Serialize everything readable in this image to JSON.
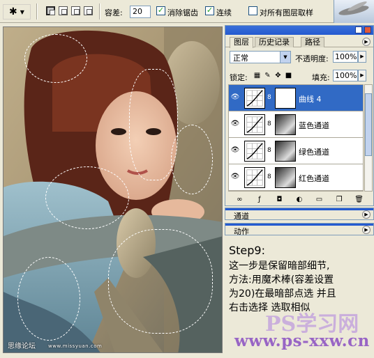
{
  "options_bar": {
    "tool_icon": "magic-wand-icon",
    "tolerance_label": "容差:",
    "tolerance_value": "20",
    "antialias_label": "消除锯齿",
    "antialias_checked": true,
    "contiguous_label": "连续",
    "contiguous_checked": true,
    "sample_all_label": "对所有图层取样",
    "sample_all_checked": false
  },
  "canvas": {
    "watermark_left": "思缘论坛",
    "watermark_url": "www.missyuan.com"
  },
  "layers_panel": {
    "tabs": [
      "图层",
      "历史记录",
      "路径"
    ],
    "active_tab": "图层",
    "blend_mode": "正常",
    "opacity_label": "不透明度:",
    "opacity_value": "100%",
    "lock_label": "锁定:",
    "fill_label": "填充:",
    "fill_value": "100%",
    "layers": [
      {
        "name": "曲线 4",
        "selected": true,
        "mask": "white"
      },
      {
        "name": "蓝色通道",
        "selected": false,
        "mask": "photo"
      },
      {
        "name": "绿色通道",
        "selected": false,
        "mask": "photo"
      },
      {
        "name": "红色通道",
        "selected": false,
        "mask": "photo"
      }
    ]
  },
  "channels_panel": {
    "title": "通道"
  },
  "actions_panel": {
    "title": "动作"
  },
  "instructions": {
    "title": "Step9:",
    "lines": [
      "这一步是保留暗部细节,",
      "方法:用魔术棒(容差设置",
      "为20)在最暗部点选 并且",
      "右击选择 选取相似"
    ]
  },
  "site_watermark": "www.ps-xxw.cn",
  "site_logo": "PS学习网",
  "colors": {
    "selection_blue": "#316ac5",
    "palette_bg": "#ece9d8",
    "titlebar_blue": "#245ad0",
    "site_purple": "#8a4ec2"
  }
}
